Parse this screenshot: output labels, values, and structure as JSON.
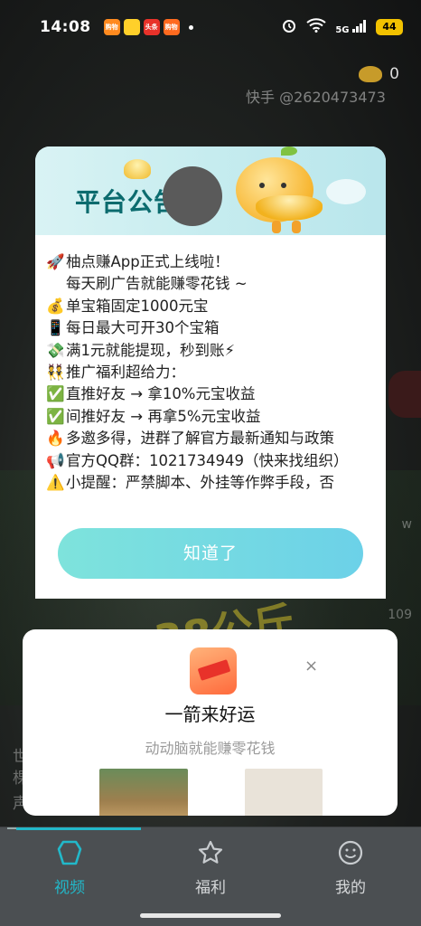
{
  "status_bar": {
    "time": "14:08",
    "apps": [
      {
        "label": "购物",
        "color": "#ff8a1f"
      },
      {
        "label": "",
        "color": "#ffd02a"
      },
      {
        "label": "头条",
        "color": "#e8322a"
      },
      {
        "label": "购物",
        "color": "#ff6a1f"
      }
    ],
    "signal": "5G",
    "battery": "44"
  },
  "overlay": {
    "coin_count": "0",
    "watermark": "快手 @2620473473",
    "side_meta": [
      "w",
      "109"
    ],
    "bg_text": "38公斤",
    "bg_captions": [
      "世",
      "棵",
      "声"
    ]
  },
  "notice": {
    "title": "平台公告",
    "lines": [
      {
        "emoji": "🚀",
        "text": "柚点赚App正式上线啦！"
      },
      {
        "emoji": "",
        "text": "每天刷广告就能赚零花钱 ~"
      },
      {
        "emoji": "💰",
        "text": "单宝箱固定1000元宝"
      },
      {
        "emoji": "📱",
        "text": "每日最大可开30个宝箱"
      },
      {
        "emoji": "💸",
        "text": "满1元就能提现，秒到账⚡"
      },
      {
        "emoji": "👯",
        "text": "推广福利超给力："
      },
      {
        "emoji": "✅",
        "text": "直推好友 → 拿10%元宝收益"
      },
      {
        "emoji": "✅",
        "text": "间推好友 → 再拿5%元宝收益"
      },
      {
        "emoji": "🔥",
        "text": "多邀多得，进群了解官方最新通知与政策"
      },
      {
        "emoji": "📢",
        "text": "官方QQ群：1021734949（快来找组织）"
      },
      {
        "emoji": "⚠️",
        "text": "小提醒：严禁脚本、外挂等作弊手段，否"
      }
    ],
    "ok_label": "知道了"
  },
  "promo": {
    "title": "一箭来好运",
    "subtitle": "动动脑就能赚零花钱",
    "close_glyph": "×"
  },
  "bottom_nav": {
    "items": [
      {
        "label": "视频",
        "active": true
      },
      {
        "label": "福利",
        "active": false
      },
      {
        "label": "我的",
        "active": false
      }
    ],
    "active_color": "#22b8c9"
  }
}
